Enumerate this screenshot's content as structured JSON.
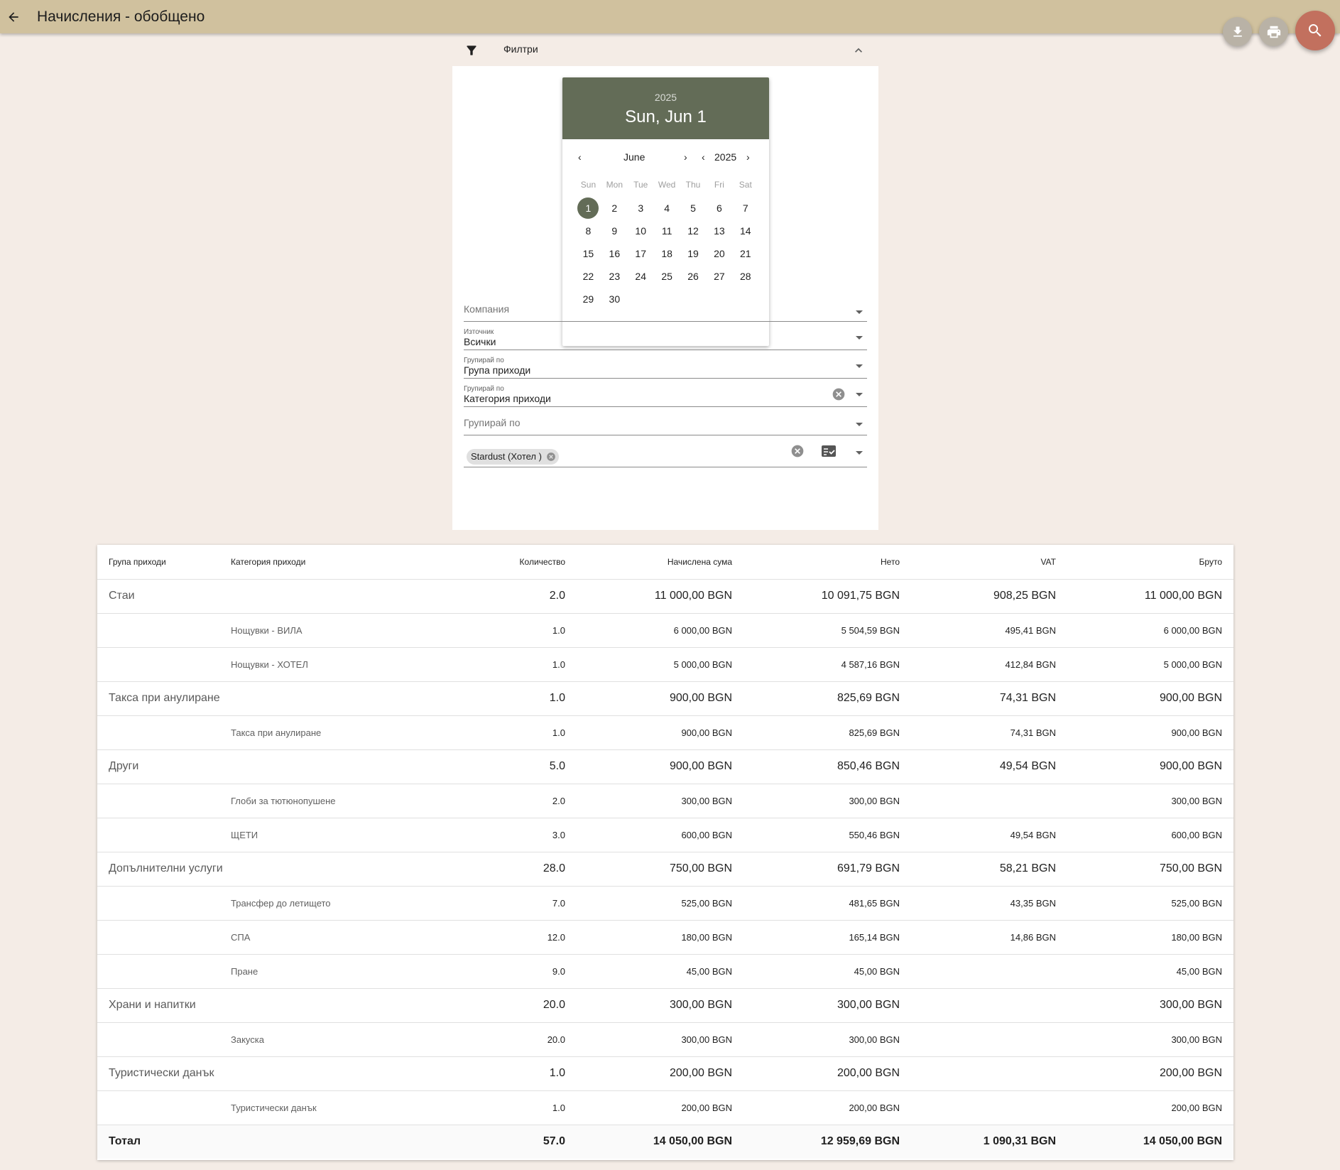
{
  "header": {
    "title": "Начисления - обобщено"
  },
  "actions": {
    "download": "download-icon",
    "print": "print-icon",
    "search": "search-icon"
  },
  "filters": {
    "label": "Филтри",
    "datepicker": {
      "year": "2025",
      "selected_date": "Sun, Jun 1",
      "month_label": "June",
      "year_label": "2025",
      "weekdays": [
        "Sun",
        "Mon",
        "Tue",
        "Wed",
        "Thu",
        "Fri",
        "Sat"
      ],
      "days": [
        "1",
        "2",
        "3",
        "4",
        "5",
        "6",
        "7",
        "8",
        "9",
        "10",
        "11",
        "12",
        "13",
        "14",
        "15",
        "16",
        "17",
        "18",
        "19",
        "20",
        "21",
        "22",
        "23",
        "24",
        "25",
        "26",
        "27",
        "28",
        "29",
        "30"
      ],
      "selected_day": "1"
    },
    "company": {
      "placeholder": "Компания"
    },
    "source": {
      "label": "Източник",
      "value": "Всички"
    },
    "group_by_1": {
      "label": "Групирай по",
      "value": "Група приходи"
    },
    "group_by_2": {
      "label": "Групирай по",
      "value": "Категория приходи"
    },
    "group_by_3": {
      "placeholder": "Групирай по"
    },
    "property": {
      "chip": "Stardust (Хотел )"
    }
  },
  "table": {
    "columns": [
      "Група приходи",
      "Категория приходи",
      "Количество",
      "Начислена сума",
      "Нето",
      "VAT",
      "Бруто"
    ],
    "rows": [
      {
        "type": "group",
        "group": "Стаи",
        "category": "",
        "qty": "2.0",
        "charged": "11 000,00 BGN",
        "net": "10 091,75 BGN",
        "vat": "908,25 BGN",
        "gross": "11 000,00 BGN"
      },
      {
        "type": "sub",
        "group": "",
        "category": "Нощувки - ВИЛА",
        "qty": "1.0",
        "charged": "6 000,00 BGN",
        "net": "5 504,59 BGN",
        "vat": "495,41 BGN",
        "gross": "6 000,00 BGN"
      },
      {
        "type": "sub",
        "group": "",
        "category": "Нощувки - ХОТЕЛ",
        "qty": "1.0",
        "charged": "5 000,00 BGN",
        "net": "4 587,16 BGN",
        "vat": "412,84 BGN",
        "gross": "5 000,00 BGN"
      },
      {
        "type": "group",
        "group": "Такса при анулиране",
        "category": "",
        "qty": "1.0",
        "charged": "900,00 BGN",
        "net": "825,69 BGN",
        "vat": "74,31 BGN",
        "gross": "900,00 BGN"
      },
      {
        "type": "sub",
        "group": "",
        "category": "Такса при анулиране",
        "qty": "1.0",
        "charged": "900,00 BGN",
        "net": "825,69 BGN",
        "vat": "74,31 BGN",
        "gross": "900,00 BGN"
      },
      {
        "type": "group",
        "group": "Други",
        "category": "",
        "qty": "5.0",
        "charged": "900,00 BGN",
        "net": "850,46 BGN",
        "vat": "49,54 BGN",
        "gross": "900,00 BGN"
      },
      {
        "type": "sub",
        "group": "",
        "category": "Глоби за тютюнопушене",
        "qty": "2.0",
        "charged": "300,00 BGN",
        "net": "300,00 BGN",
        "vat": "",
        "gross": "300,00 BGN"
      },
      {
        "type": "sub",
        "group": "",
        "category": "ЩЕТИ",
        "qty": "3.0",
        "charged": "600,00 BGN",
        "net": "550,46 BGN",
        "vat": "49,54 BGN",
        "gross": "600,00 BGN"
      },
      {
        "type": "group",
        "group": "Допълнителни услуги",
        "category": "",
        "qty": "28.0",
        "charged": "750,00 BGN",
        "net": "691,79 BGN",
        "vat": "58,21 BGN",
        "gross": "750,00 BGN"
      },
      {
        "type": "sub",
        "group": "",
        "category": "Трансфер до летището",
        "qty": "7.0",
        "charged": "525,00 BGN",
        "net": "481,65 BGN",
        "vat": "43,35 BGN",
        "gross": "525,00 BGN"
      },
      {
        "type": "sub",
        "group": "",
        "category": "СПА",
        "qty": "12.0",
        "charged": "180,00 BGN",
        "net": "165,14 BGN",
        "vat": "14,86 BGN",
        "gross": "180,00 BGN"
      },
      {
        "type": "sub",
        "group": "",
        "category": "Пране",
        "qty": "9.0",
        "charged": "45,00 BGN",
        "net": "45,00 BGN",
        "vat": "",
        "gross": "45,00 BGN"
      },
      {
        "type": "group",
        "group": "Храни и напитки",
        "category": "",
        "qty": "20.0",
        "charged": "300,00 BGN",
        "net": "300,00 BGN",
        "vat": "",
        "gross": "300,00 BGN"
      },
      {
        "type": "sub",
        "group": "",
        "category": "Закуска",
        "qty": "20.0",
        "charged": "300,00 BGN",
        "net": "300,00 BGN",
        "vat": "",
        "gross": "300,00 BGN"
      },
      {
        "type": "group",
        "group": "Туристически данък",
        "category": "",
        "qty": "1.0",
        "charged": "200,00 BGN",
        "net": "200,00 BGN",
        "vat": "",
        "gross": "200,00 BGN"
      },
      {
        "type": "sub",
        "group": "",
        "category": "Туристически данък",
        "qty": "1.0",
        "charged": "200,00 BGN",
        "net": "200,00 BGN",
        "vat": "",
        "gross": "200,00 BGN"
      }
    ],
    "total": {
      "label": "Тотал",
      "qty": "57.0",
      "charged": "14 050,00 BGN",
      "net": "12 959,69 BGN",
      "vat": "1 090,31 BGN",
      "gross": "14 050,00 BGN"
    }
  }
}
